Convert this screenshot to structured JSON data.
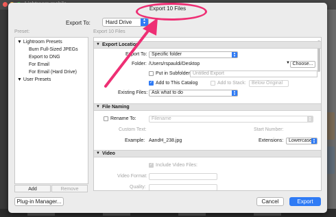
{
  "background": {
    "app_title": "Lightroom mobile"
  },
  "dialog": {
    "title": "Export 10 Files",
    "export_to_label": "Export To:",
    "export_to_value": "Hard Drive",
    "preset_header": "Preset:",
    "settings_header": "Export 10 Files"
  },
  "presets": {
    "groups": [
      {
        "label": "Lightroom Presets"
      },
      {
        "label": "User Presets"
      }
    ],
    "items": [
      "Burn Full-Sized JPEGs",
      "Export to DNG",
      "For Email",
      "For Email (Hard Drive)"
    ],
    "add_label": "Add",
    "remove_label": "Remove"
  },
  "export_location": {
    "header": "Export Location",
    "export_to_label": "Export To:",
    "export_to_value": "Specific folder",
    "folder_label": "Folder:",
    "folder_path": "/Users/rspauldi/Desktop",
    "choose_label": "Choose...",
    "subfolder_label": "Put in Subfolder:",
    "subfolder_placeholder": "Untitled Export",
    "add_catalog_label": "Add to This Catalog",
    "add_stack_label": "Add to Stack:",
    "stack_position": "Below Original",
    "existing_files_label": "Existing Files:",
    "existing_files_value": "Ask what to do"
  },
  "file_naming": {
    "header": "File Naming",
    "rename_label": "Rename To:",
    "rename_value": "Filename",
    "custom_text_label": "Custom Text:",
    "start_number_label": "Start Number:",
    "example_label": "Example:",
    "example_value": "AandH_238.jpg",
    "extensions_label": "Extensions:",
    "extensions_value": "Lowercase"
  },
  "video": {
    "header": "Video",
    "include_label": "Include Video Files:",
    "format_label": "Video Format:",
    "quality_label": "Quality:"
  },
  "footer": {
    "plugin_manager": "Plug-in Manager...",
    "cancel": "Cancel",
    "export": "Export"
  },
  "colors": {
    "annotation": "#ee2f74",
    "accent": "#2f7bf5"
  }
}
